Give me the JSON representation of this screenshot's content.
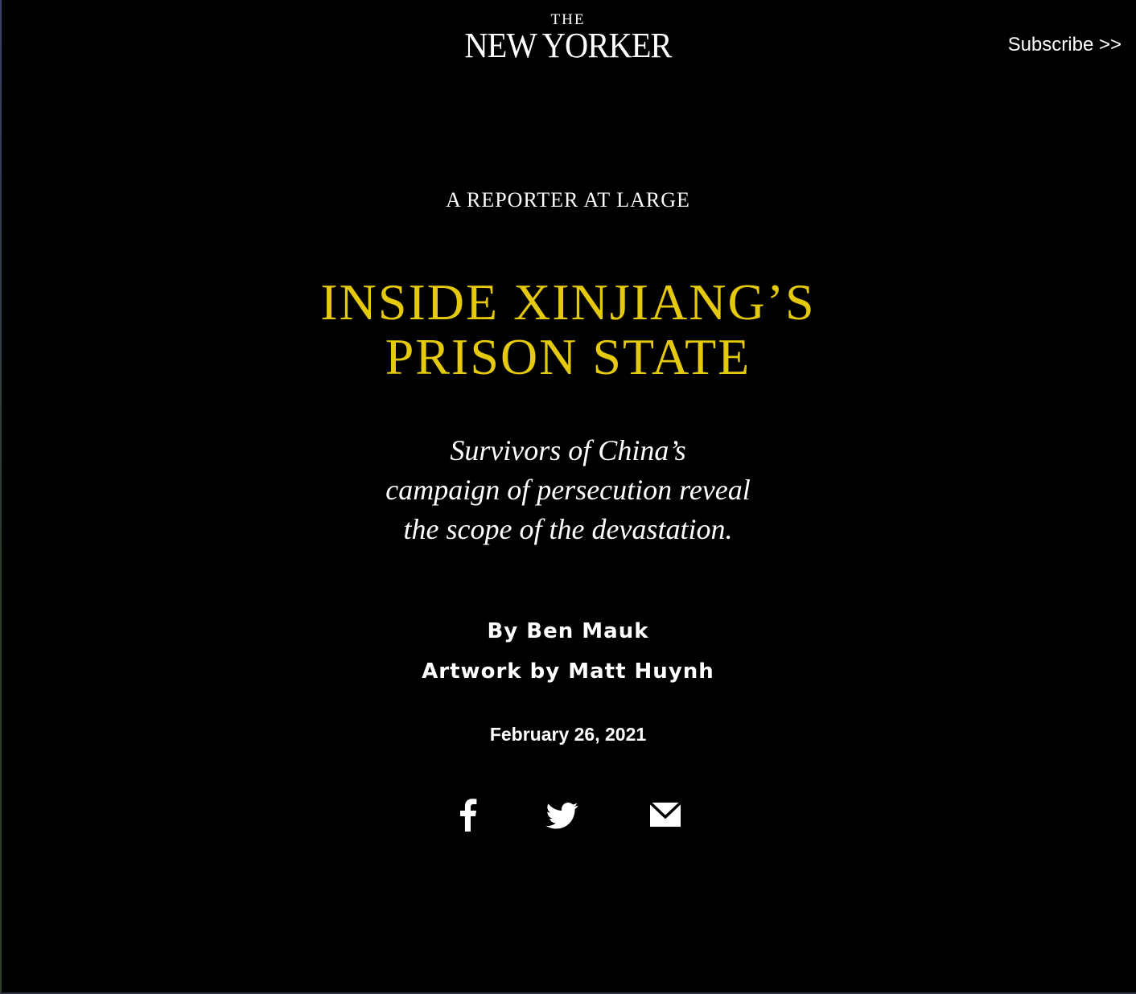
{
  "header": {
    "masthead_the": "THE",
    "masthead_name": "NEW YORKER",
    "subscribe_label": "Subscribe >>"
  },
  "article": {
    "rubric": "A REPORTER AT LARGE",
    "headline_line1": "INSIDE XINJIANG’S",
    "headline_line2": "PRISON STATE",
    "dek_line1": "Survivors of China’s",
    "dek_line2": "campaign of persecution reveal",
    "dek_line3": "the scope of the devastation.",
    "byline": "By Ben Mauk",
    "artwork_credit": "Artwork by Matt Huynh",
    "date": "February 26, 2021"
  },
  "share": {
    "icons": [
      "facebook-icon",
      "twitter-icon",
      "email-icon"
    ]
  },
  "colors": {
    "background": "#000000",
    "headline": "#e5c90d",
    "text": "#ffffff"
  }
}
